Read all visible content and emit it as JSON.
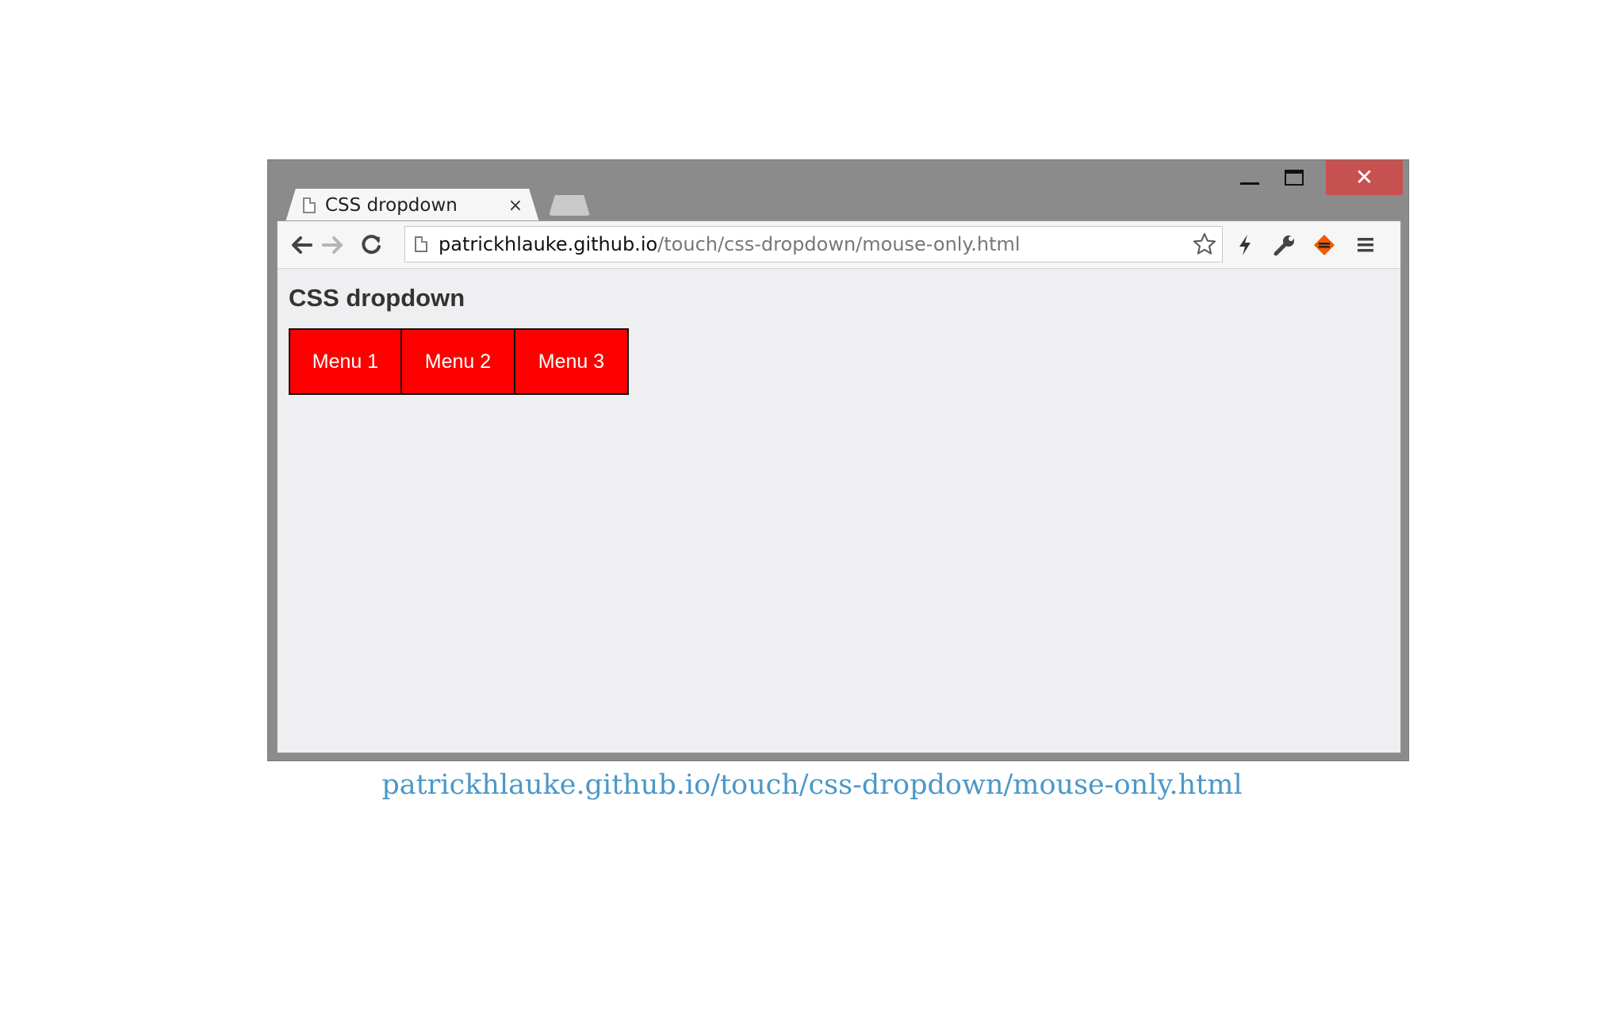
{
  "window": {
    "controls": {
      "minimize": "minimize",
      "maximize": "maximize",
      "close": "✕"
    },
    "close_color": "#c75050",
    "frame_color": "#8b8b8b"
  },
  "tab": {
    "title": "CSS dropdown",
    "close": "×"
  },
  "toolbar": {
    "url_host": "patrickhlauke.github.io",
    "url_path": "/touch/css-dropdown/mouse-only.html",
    "icons": [
      "back-arrow-icon",
      "forward-arrow-icon",
      "reload-icon",
      "page-icon",
      "star-icon",
      "lightning-icon",
      "wrench-icon",
      "extension-icon",
      "menu-icon"
    ]
  },
  "page": {
    "heading": "CSS dropdown",
    "menu": [
      {
        "label": "Menu 1"
      },
      {
        "label": "Menu 2"
      },
      {
        "label": "Menu 3"
      }
    ],
    "menu_color": "#ff0000"
  },
  "caption": {
    "text": "patrickhlauke.github.io/touch/css-dropdown/mouse-only.html",
    "color": "#4a98c9"
  }
}
